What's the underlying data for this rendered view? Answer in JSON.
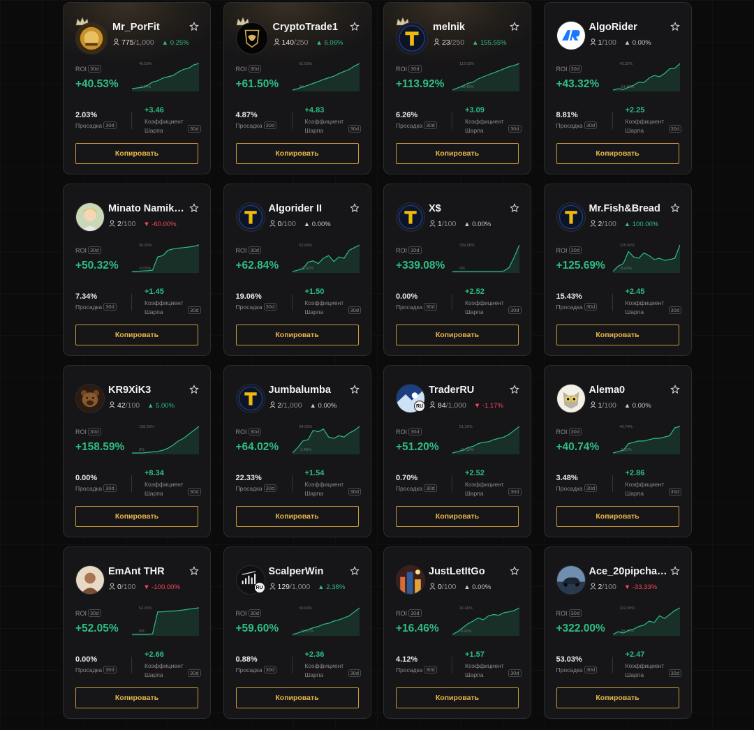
{
  "labels": {
    "roi": "ROI",
    "period": "30d",
    "drawdown": "Просадка",
    "sharpe": "Коэффициент Шарпа",
    "copy": "Копировать"
  },
  "colors": {
    "accent": "#e8b64a",
    "up": "#2ebd85",
    "down": "#f6465d",
    "card": "#161618",
    "background": "#0b0b0c"
  },
  "traders": [
    {
      "name": "Mr_PorFit",
      "followers": "775",
      "capacity": "/1,000",
      "change": "0.25%",
      "dir": "up",
      "roi": "+40.53%",
      "chart_top": "40.53%",
      "chart_bot": "-1.34%",
      "drawdown": "2.03%",
      "sharpe": "+3.46",
      "avatar": "gold-bull-icon",
      "crown": true,
      "glow": true,
      "curve": [
        0.05,
        0.08,
        0.1,
        0.18,
        0.3,
        0.35,
        0.45,
        0.5,
        0.55,
        0.68,
        0.78,
        0.82,
        0.95,
        1.0
      ]
    },
    {
      "name": "CryptoTrade1",
      "followers": "140",
      "capacity": "/250",
      "change": "6.06%",
      "dir": "up",
      "roi": "+61.50%",
      "chart_top": "61.50%",
      "chart_bot": "0%",
      "drawdown": "4.87%",
      "sharpe": "+4.83",
      "avatar": "lamborghini-logo-icon",
      "crown": true,
      "glow": true,
      "curve": [
        0.0,
        0.05,
        0.12,
        0.18,
        0.25,
        0.32,
        0.4,
        0.46,
        0.52,
        0.62,
        0.7,
        0.78,
        0.9,
        1.0
      ]
    },
    {
      "name": "melnik",
      "followers": "23",
      "capacity": "/250",
      "change": "155.55%",
      "dir": "up",
      "roi": "+113.92%",
      "chart_top": "113.92%",
      "chart_bot": "-40.42%",
      "drawdown": "6.26%",
      "sharpe": "+3.09",
      "avatar": "t-logo-icon",
      "crown": true,
      "glow": true,
      "curve": [
        0.0,
        0.08,
        0.15,
        0.25,
        0.3,
        0.42,
        0.5,
        0.58,
        0.65,
        0.72,
        0.8,
        0.88,
        0.93,
        1.0
      ]
    },
    {
      "name": "AlgoRider",
      "followers": "1",
      "capacity": "/100",
      "change": "0.00%",
      "dir": "flat",
      "roi": "+43.32%",
      "chart_top": "43.32%",
      "chart_bot": "-13.46%",
      "drawdown": "8.81%",
      "sharpe": "+2.25",
      "avatar": "ar-logo-icon",
      "crown": false,
      "glow": false,
      "curve": [
        0.0,
        0.05,
        0.02,
        0.1,
        0.18,
        0.3,
        0.28,
        0.45,
        0.55,
        0.5,
        0.62,
        0.8,
        0.82,
        1.0
      ]
    },
    {
      "name": "Minato Namik…",
      "followers": "2",
      "capacity": "/100",
      "change": "-60.00%",
      "dir": "down",
      "roi": "+50.32%",
      "chart_top": "50.32%",
      "chart_bot": "-0.05%",
      "drawdown": "7.34%",
      "sharpe": "+1.45",
      "avatar": "anime-avatar-icon",
      "crown": false,
      "glow": false,
      "curve": [
        0.0,
        0.0,
        0.02,
        0.03,
        0.05,
        0.55,
        0.6,
        0.8,
        0.85,
        0.88,
        0.9,
        0.92,
        0.95,
        1.0
      ]
    },
    {
      "name": "Algorider II",
      "followers": "0",
      "capacity": "/100",
      "change": "0.00%",
      "dir": "flat",
      "roi": "+62.84%",
      "chart_top": "62.84%",
      "chart_bot": "-15.42%",
      "drawdown": "19.06%",
      "sharpe": "+1.50",
      "avatar": "t-logo-icon",
      "crown": false,
      "glow": false,
      "curve": [
        0.0,
        0.05,
        0.1,
        0.35,
        0.4,
        0.3,
        0.5,
        0.6,
        0.38,
        0.55,
        0.5,
        0.8,
        0.9,
        1.0
      ]
    },
    {
      "name": "X$",
      "followers": "1",
      "capacity": "/100",
      "change": "0.00%",
      "dir": "flat",
      "roi": "+339.08%",
      "chart_top": "339.08%",
      "chart_bot": "0%",
      "drawdown": "0.00%",
      "sharpe": "+2.52",
      "avatar": "t-logo-icon",
      "crown": false,
      "glow": false,
      "curve": [
        0.0,
        0.0,
        0.0,
        0.0,
        0.0,
        0.0,
        0.0,
        0.0,
        0.0,
        0.0,
        0.02,
        0.15,
        0.55,
        1.0
      ]
    },
    {
      "name": "Mr.Fish&Bread",
      "followers": "2",
      "capacity": "/100",
      "change": "100.00%",
      "dir": "up",
      "roi": "+125.69%",
      "chart_top": "125.69%",
      "chart_bot": "-8.42%",
      "drawdown": "15.43%",
      "sharpe": "+2.45",
      "avatar": "t-logo-icon",
      "crown": false,
      "glow": false,
      "curve": [
        0.0,
        0.2,
        0.3,
        0.75,
        0.55,
        0.5,
        0.7,
        0.6,
        0.45,
        0.5,
        0.42,
        0.45,
        0.5,
        1.0
      ]
    },
    {
      "name": "KR9XiK3",
      "followers": "42",
      "capacity": "/100",
      "change": "5.00%",
      "dir": "up",
      "roi": "+158.59%",
      "chart_top": "158.59%",
      "chart_bot": "0%",
      "drawdown": "0.00%",
      "sharpe": "+8.34",
      "avatar": "bear-icon",
      "crown": false,
      "glow": false,
      "curve": [
        0.0,
        0.0,
        0.0,
        0.02,
        0.04,
        0.06,
        0.1,
        0.18,
        0.3,
        0.45,
        0.55,
        0.7,
        0.85,
        1.0
      ]
    },
    {
      "name": "Jumbalumba",
      "followers": "2",
      "capacity": "/1,000",
      "change": "0.00%",
      "dir": "flat",
      "roi": "+64.02%",
      "chart_top": "64.02%",
      "chart_bot": "-1.46%",
      "drawdown": "22.33%",
      "sharpe": "+1.54",
      "avatar": "t-logo-icon",
      "crown": false,
      "glow": false,
      "curve": [
        0.0,
        0.2,
        0.45,
        0.5,
        0.85,
        0.8,
        0.9,
        0.6,
        0.55,
        0.65,
        0.6,
        0.75,
        0.85,
        1.0
      ]
    },
    {
      "name": "TraderRU",
      "followers": "84",
      "capacity": "/1,000",
      "change": "-1.17%",
      "dir": "down",
      "roi": "+51.20%",
      "chart_top": "51.20%",
      "chart_bot": "-31.18%",
      "drawdown": "0.70%",
      "sharpe": "+2.52",
      "avatar": "trader-ru-avatar-icon",
      "crown": false,
      "glow": false,
      "ru": true,
      "curve": [
        0.0,
        0.05,
        0.1,
        0.2,
        0.25,
        0.35,
        0.4,
        0.42,
        0.5,
        0.55,
        0.6,
        0.7,
        0.85,
        1.0
      ]
    },
    {
      "name": "Alema0",
      "followers": "1",
      "capacity": "/100",
      "change": "0.00%",
      "dir": "flat",
      "roi": "+40.74%",
      "chart_top": "40.74%",
      "chart_bot": "-3.32%",
      "drawdown": "3.48%",
      "sharpe": "+2.86",
      "avatar": "owl-avatar-icon",
      "crown": false,
      "glow": false,
      "curve": [
        0.0,
        0.05,
        0.1,
        0.35,
        0.4,
        0.45,
        0.45,
        0.5,
        0.55,
        0.55,
        0.6,
        0.65,
        0.95,
        1.0
      ]
    },
    {
      "name": "EmAnt THR",
      "followers": "0",
      "capacity": "/100",
      "change": "-100.00%",
      "dir": "down",
      "roi": "+52.05%",
      "chart_top": "52.05%",
      "chart_bot": "0%",
      "drawdown": "0.00%",
      "sharpe": "+2.66",
      "avatar": "photo-avatar-icon",
      "crown": false,
      "glow": false,
      "curve": [
        0.0,
        0.0,
        0.0,
        0.0,
        0.02,
        0.85,
        0.85,
        0.88,
        0.88,
        0.9,
        0.92,
        0.95,
        0.98,
        1.0
      ]
    },
    {
      "name": "ScalperWin",
      "followers": "129",
      "capacity": "/1,000",
      "change": "2.38%",
      "dir": "up",
      "roi": "+59.60%",
      "chart_top": "59.60%",
      "chart_bot": "-21.37%",
      "drawdown": "0.88%",
      "sharpe": "+2.36",
      "avatar": "scalper-logo-icon",
      "crown": false,
      "glow": false,
      "ru": true,
      "curve": [
        0.0,
        0.05,
        0.12,
        0.18,
        0.25,
        0.3,
        0.38,
        0.42,
        0.5,
        0.55,
        0.62,
        0.7,
        0.85,
        1.0
      ]
    },
    {
      "name": "JustLetItGo",
      "followers": "0",
      "capacity": "/100",
      "change": "0.00%",
      "dir": "flat",
      "roi": "+16.46%",
      "chart_top": "16.46%",
      "chart_bot": "-3.92%",
      "drawdown": "4.12%",
      "sharpe": "+1.57",
      "avatar": "city-avatar-icon",
      "crown": false,
      "glow": false,
      "curve": [
        0.0,
        0.1,
        0.25,
        0.4,
        0.5,
        0.62,
        0.55,
        0.7,
        0.75,
        0.72,
        0.82,
        0.85,
        0.9,
        1.0
      ]
    },
    {
      "name": "Ace_20pipcha…",
      "followers": "2",
      "capacity": "/100",
      "change": "-33.33%",
      "dir": "down",
      "roi": "+322.00%",
      "chart_top": "322.00%",
      "chart_bot": "-28.17%",
      "drawdown": "53.03%",
      "sharpe": "+2.47",
      "avatar": "car-avatar-icon",
      "crown": false,
      "glow": false,
      "curve": [
        0.0,
        0.1,
        0.05,
        0.15,
        0.2,
        0.3,
        0.35,
        0.5,
        0.45,
        0.7,
        0.6,
        0.75,
        0.9,
        1.0
      ]
    }
  ]
}
